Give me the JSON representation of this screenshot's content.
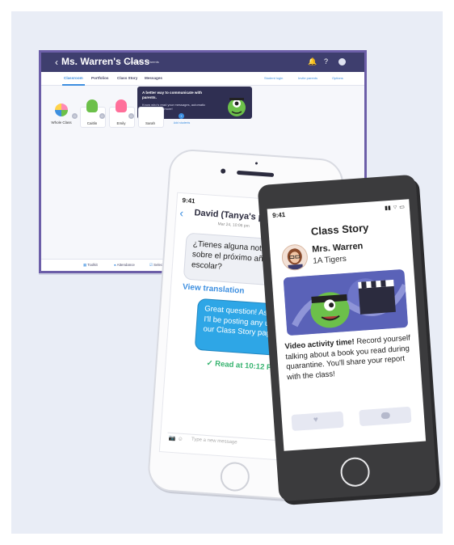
{
  "browser": {
    "back_icon": "‹",
    "class_name": "Ms. Warren's Class",
    "meta": "5 Students · 0 Parents",
    "tabs": [
      "Classroom",
      "Portfolios",
      "Class Story",
      "Messages"
    ],
    "active_tab": "Classroom",
    "right_links": [
      "Student login",
      "Invite parents",
      "Options"
    ],
    "students": [
      "Whole Class",
      "Caitlin",
      "Emily",
      "Sarah"
    ],
    "add_students": "Add students",
    "tooltip": {
      "title": "A better way to communicate with parents.",
      "body": "Know who's read your messages, automatic translation and more!"
    },
    "bottom": [
      "Toolkit",
      "Attendance",
      "Select"
    ]
  },
  "chat_phone": {
    "time": "9:41",
    "contact": "David (Tanya's parent)",
    "date": "Mar 24, 10:06 pm",
    "incoming": "¿Tienes alguna noticia sobre el próximo año escolar?",
    "view_translation": "View translation",
    "outgoing": "Great question! As I get info, I'll be posting any updates on our Class Story page 😊",
    "read_receipt": "✓ Read at 10:12 PM",
    "input_placeholder": "Type a new message"
  },
  "story_phone": {
    "time": "9:41",
    "title": "Class Story",
    "teacher": "Mrs. Warren",
    "class": "1A Tigers",
    "caption_bold": "Video activity time!",
    "caption": " Record yourself talking about a book you read during quarantine. You'll share your report with the class!",
    "like_icon": "♥",
    "comment_icon": "💬"
  }
}
